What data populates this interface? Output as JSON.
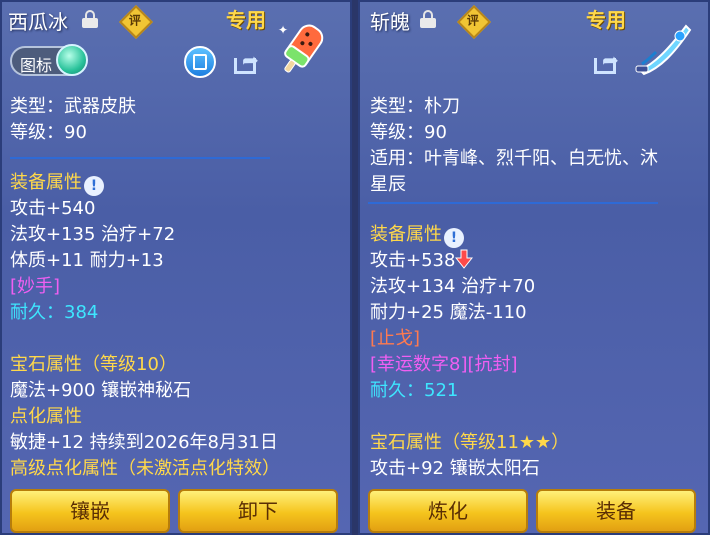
{
  "left": {
    "title": "西瓜冰",
    "eval_label": "评",
    "special_label": "专用",
    "icon_toggle_label": "图标",
    "type_line": "类型：武器皮肤",
    "level_line": "等级：90",
    "equip_attr_title": "装备属性",
    "attr_lines": [
      "攻击+540",
      "法攻+135 治疗+72",
      "体质+11 耐力+13"
    ],
    "skill": "[妙手]",
    "durability_label": "耐久：",
    "durability_value": "384",
    "gem_title": "宝石属性（等级10）",
    "gem_line": "魔法+900 镶嵌神秘石",
    "refine_title": "点化属性",
    "refine_line": "敏捷+12 持续到2026年8月31日",
    "adv_refine": "高级点化属性（未激活点化特效）",
    "buttons": [
      "镶嵌",
      "卸下"
    ]
  },
  "right": {
    "title": "斩魄",
    "eval_label": "评",
    "special_label": "专用",
    "type_line": "类型：朴刀",
    "level_line": "等级：90",
    "use_line1": "适用：叶青峰、烈千阳、白无忧、沐",
    "use_line2": "星辰",
    "equip_attr_title": "装备属性",
    "attr_first": "攻击+538",
    "attr_lines": [
      "法攻+134 治疗+70",
      "耐力+25 魔法-110"
    ],
    "skill": "[止戈]",
    "special_attrs": "[幸运数字8][抗封]",
    "durability_label": "耐久：",
    "durability_value": "521",
    "gem_title": "宝石属性（等级11★★）",
    "gem_line": "攻击+92 镶嵌太阳石",
    "buttons": [
      "炼化",
      "装备"
    ]
  },
  "info_icon_glyph": "!",
  "colors": {
    "gold": "#ffd84a",
    "cyan": "#3ee6ff",
    "pink": "#f05ff2",
    "red": "#ff7a4f"
  }
}
